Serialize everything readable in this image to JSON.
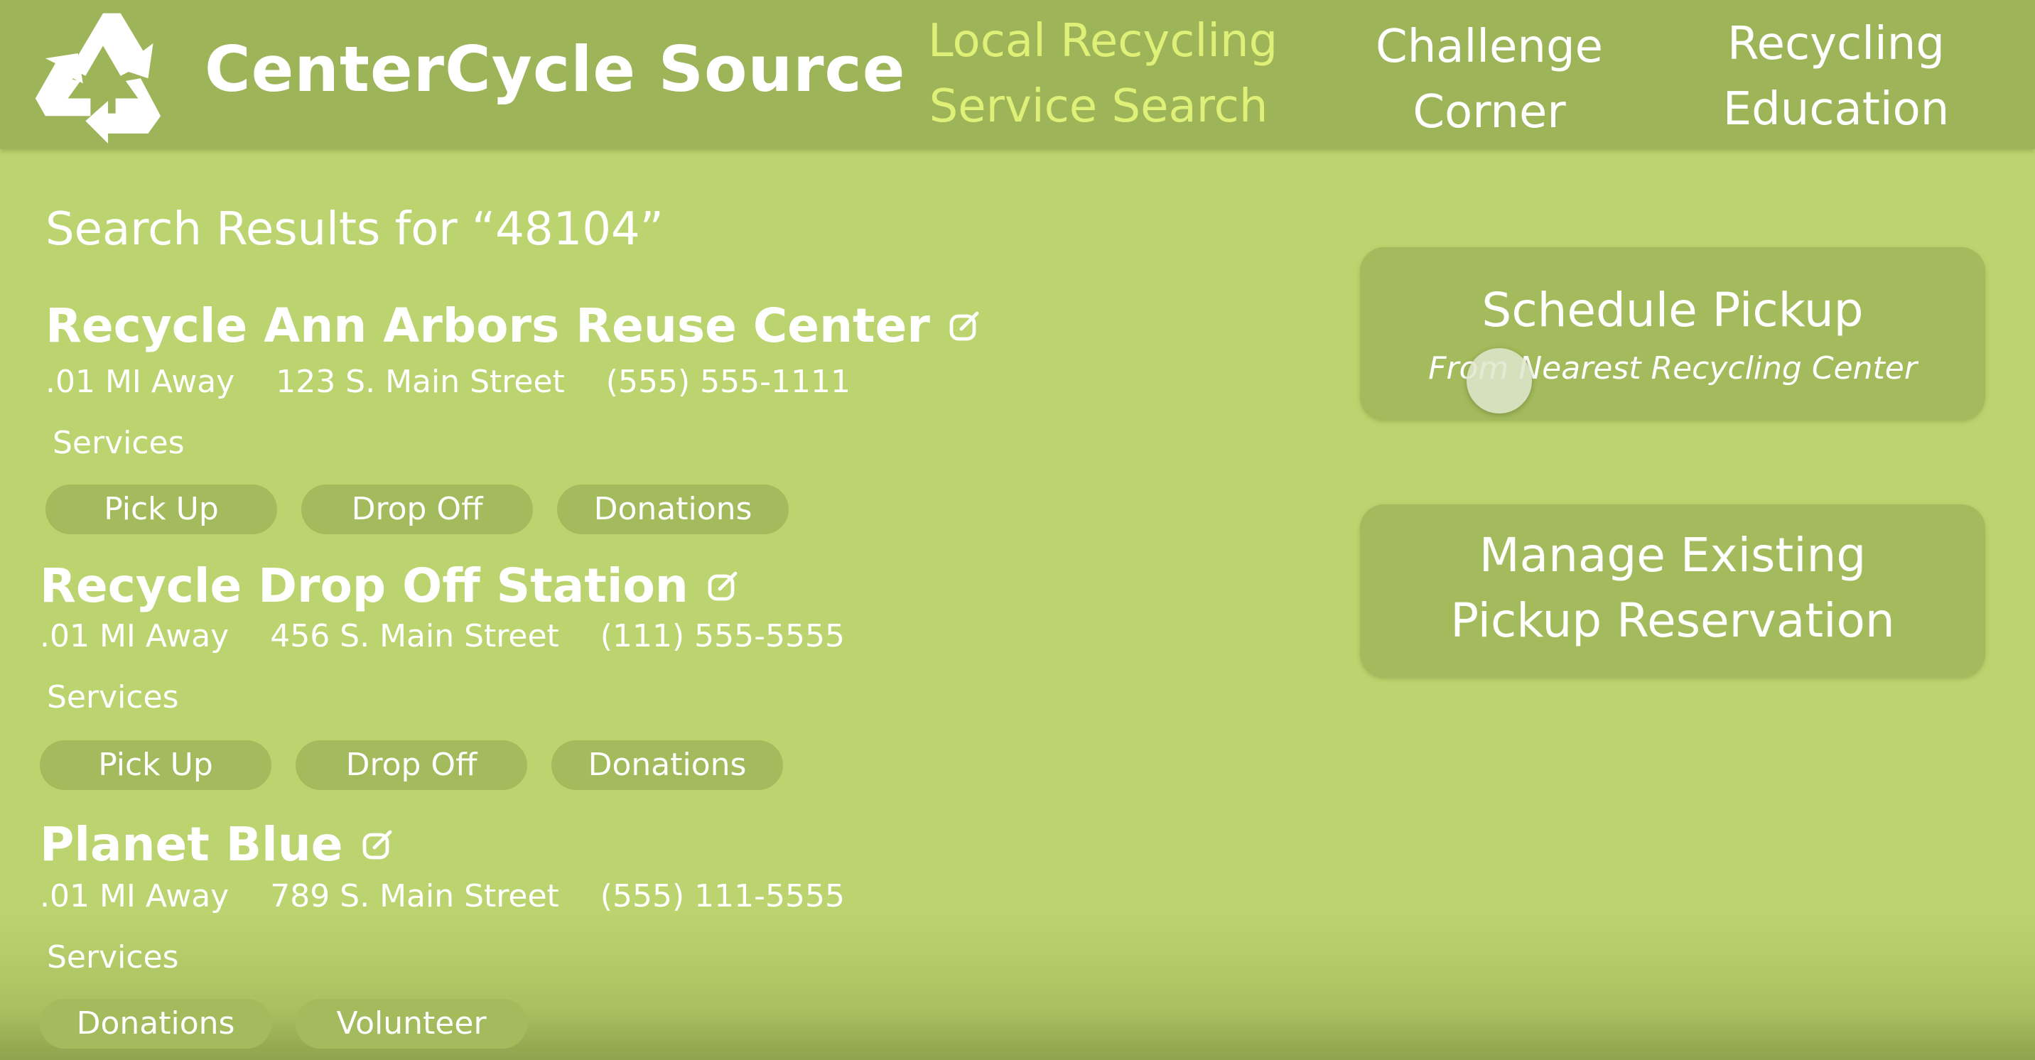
{
  "header": {
    "brand": "CenterCycle Source",
    "logo_icon": "recycle-icon",
    "nav": [
      {
        "line1": "Local Recycling",
        "line2": "Service Search",
        "active": true
      },
      {
        "line1": "Challenge",
        "line2": "Corner",
        "active": false
      },
      {
        "line1": "Recycling",
        "line2": "Education",
        "active": false
      }
    ]
  },
  "search": {
    "title": "Search Results for “48104”"
  },
  "services_label": "Services",
  "external_link_icon": "external-link-icon",
  "results": [
    {
      "name": "Recycle Ann Arbors Reuse Center",
      "distance": ".01 MI Away",
      "address": "123 S. Main Street",
      "phone": "(555) 555-1111",
      "services": [
        "Pick Up",
        "Drop Off",
        "Donations"
      ]
    },
    {
      "name": "Recycle Drop Off Station",
      "distance": ".01 MI Away",
      "address": "456 S. Main Street",
      "phone": "(111) 555-5555",
      "services": [
        "Pick Up",
        "Drop Off",
        "Donations"
      ]
    },
    {
      "name": "Planet Blue",
      "distance": ".01 MI Away",
      "address": "789 S. Main Street",
      "phone": "(555) 111-5555",
      "services": [
        "Donations",
        "Volunteer"
      ]
    }
  ],
  "actions": {
    "schedule_title": "Schedule Pickup",
    "schedule_subtitle": "From Nearest Recycling Center",
    "manage_line1": "Manage Existing",
    "manage_line2": "Pickup Reservation"
  },
  "colors": {
    "page_background": "#bcd46f",
    "header_background": "#9db458",
    "active_nav": "#dff078",
    "button_background": "#a3bb5c",
    "text": "#ffffff"
  }
}
